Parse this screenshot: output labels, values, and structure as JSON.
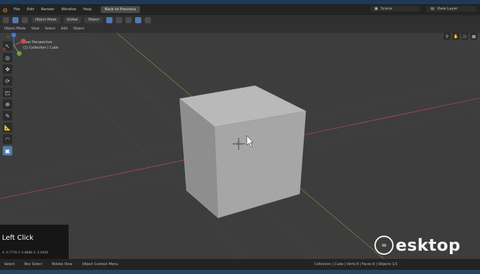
{
  "menubar": {
    "items": [
      "File",
      "Edit",
      "Render",
      "Window",
      "Help"
    ],
    "back_button": "Back to Previous",
    "scene_field": "Scene",
    "view_layer_field": "View Layer"
  },
  "toolbar": {
    "mode": "Object Mode",
    "global": "Global",
    "object": "Object"
  },
  "subheader": {
    "items": [
      "Object Mode",
      "View",
      "Select",
      "Add",
      "Object"
    ]
  },
  "viewport": {
    "view_label": "User Perspective",
    "collection_label": "(1) Collection | Cube"
  },
  "overlay": {
    "title": "Left Click",
    "info": "X: 0.7778  Y: 0.8888  Z: 0.0000"
  },
  "statusbar": {
    "items": [
      "Select",
      "Box Select",
      "Rotate View",
      "Object Context Menu"
    ],
    "right_info": "Collection | Cube | Verts 8 | Faces 6 | Objects 1/1"
  },
  "watermark": {
    "text": "esktop"
  },
  "colors": {
    "accent_blue": "#4f79b3",
    "background_viewport": "#3d3d3d",
    "x_axis": "#b24a4a",
    "y_axis": "#6d8a3a"
  }
}
